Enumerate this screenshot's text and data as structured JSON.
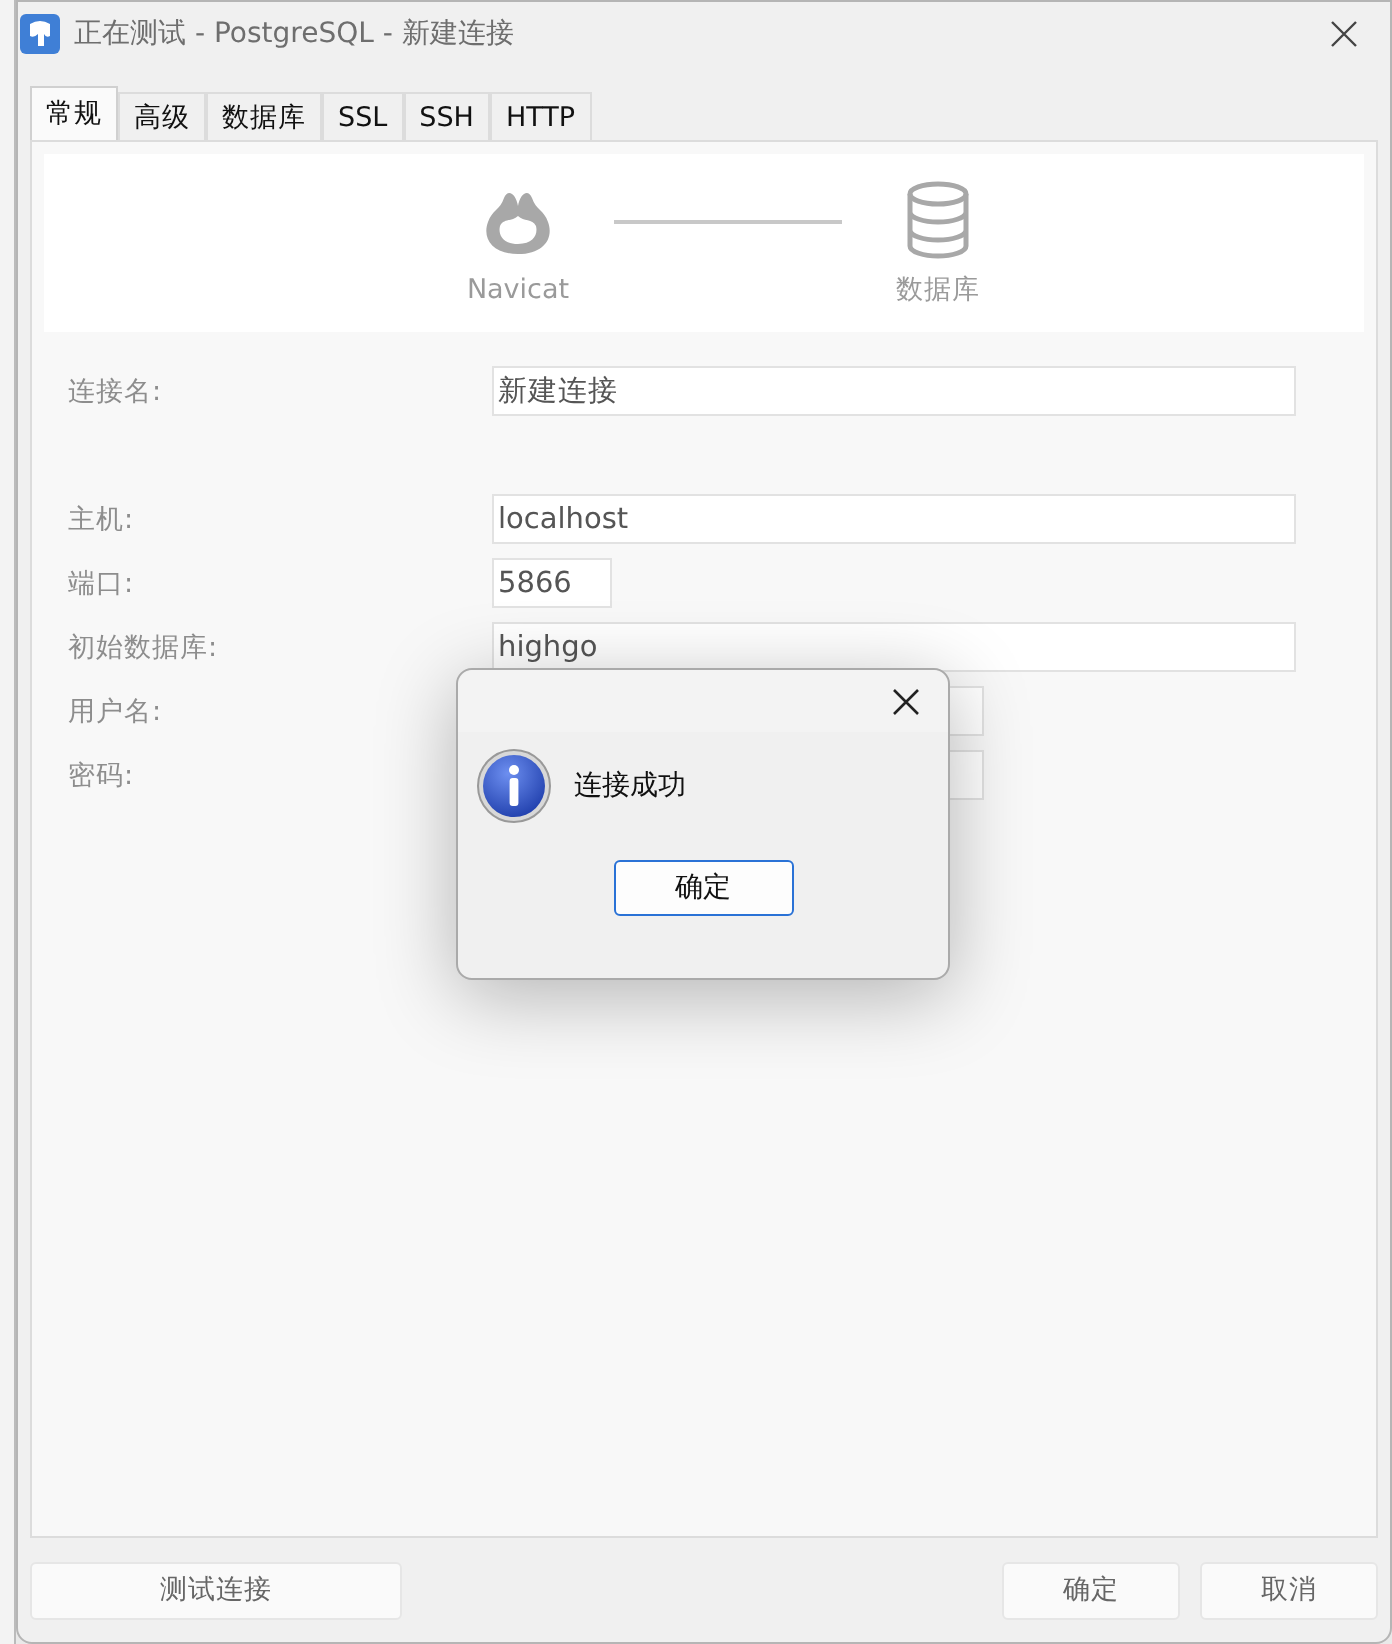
{
  "window": {
    "title": "正在测试 - PostgreSQL - 新建连接"
  },
  "tabs": [
    {
      "label": "常规",
      "selected": true
    },
    {
      "label": "高级",
      "selected": false
    },
    {
      "label": "数据库",
      "selected": false
    },
    {
      "label": "SSL",
      "selected": false
    },
    {
      "label": "SSH",
      "selected": false
    },
    {
      "label": "HTTP",
      "selected": false
    }
  ],
  "header": {
    "left_label": "Navicat",
    "right_label": "数据库"
  },
  "field_groups": [
    {
      "fields": [
        {
          "label": "连接名:",
          "value": "新建连接",
          "kind": "wide"
        }
      ]
    },
    {
      "fields": [
        {
          "label": "主机:",
          "value": "localhost",
          "kind": "wide"
        },
        {
          "label": "端口:",
          "value": "5866",
          "kind": "short"
        },
        {
          "label": "初始数据库:",
          "value": "highgo",
          "kind": "wide"
        },
        {
          "label": "用户名:",
          "kind": "medium"
        },
        {
          "label": "密码:",
          "kind": "medium"
        }
      ]
    }
  ],
  "dialog": {
    "message": "连接成功",
    "button": "确定"
  },
  "footer": {
    "test_button": "测试连接",
    "ok_button": "确定",
    "cancel_button": "取消"
  }
}
